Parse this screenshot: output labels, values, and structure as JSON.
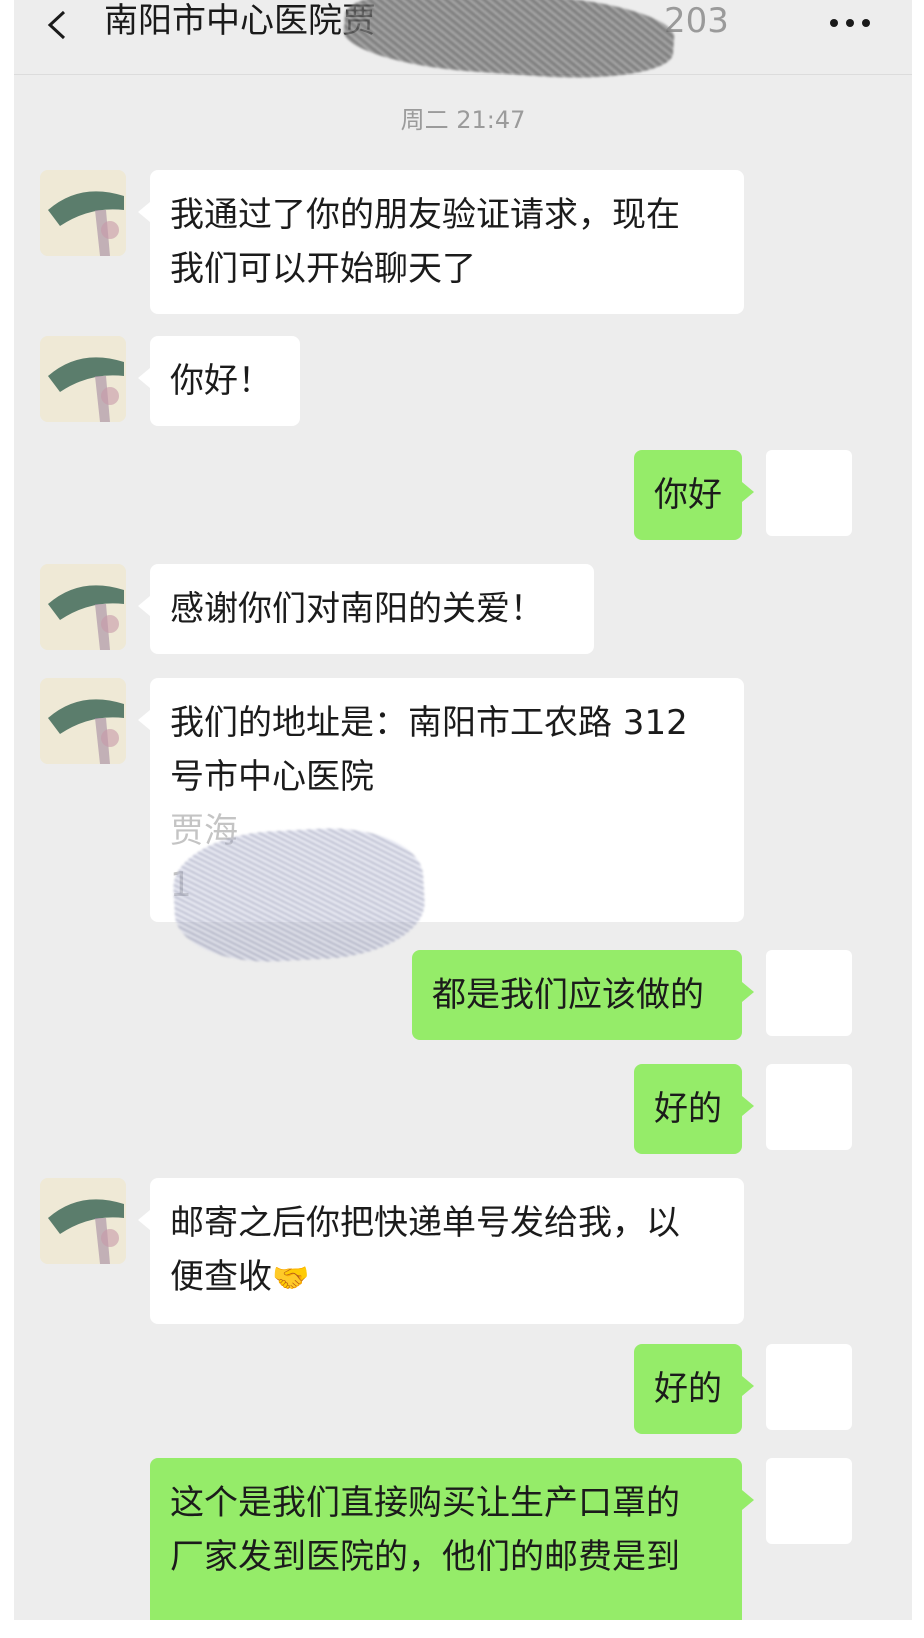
{
  "nav": {
    "back_icon": "chevron-left-icon",
    "title": "南阳市中心医院贾",
    "title_suffix": "203",
    "more_icon": "more-horizontal-icon"
  },
  "timestamp": "周二 21:47",
  "messages": [
    {
      "side": "left",
      "line1": "我通过了你的朋友验证请求，现在",
      "line2": "我们可以开始聊天了"
    },
    {
      "side": "left",
      "text": "你好！"
    },
    {
      "side": "right",
      "text": "你好"
    },
    {
      "side": "left",
      "text": "感谢你们对南阳的关爱！"
    },
    {
      "side": "left",
      "line1": "我们的地址是：南阳市工农路 312",
      "line2": "号市中心医院",
      "line3": "贾海",
      "line4": "1"
    },
    {
      "side": "right",
      "text": "都是我们应该做的"
    },
    {
      "side": "right",
      "text": "好的"
    },
    {
      "side": "left",
      "line1": "邮寄之后你把快递单号发给我，以",
      "line2": "便查收",
      "emoji": "🤝"
    },
    {
      "side": "right",
      "text": "好的"
    },
    {
      "side": "right",
      "line1": "这个是我们直接购买让生产口罩的",
      "line2": "厂家发到医院的，他们的邮费是到"
    }
  ]
}
